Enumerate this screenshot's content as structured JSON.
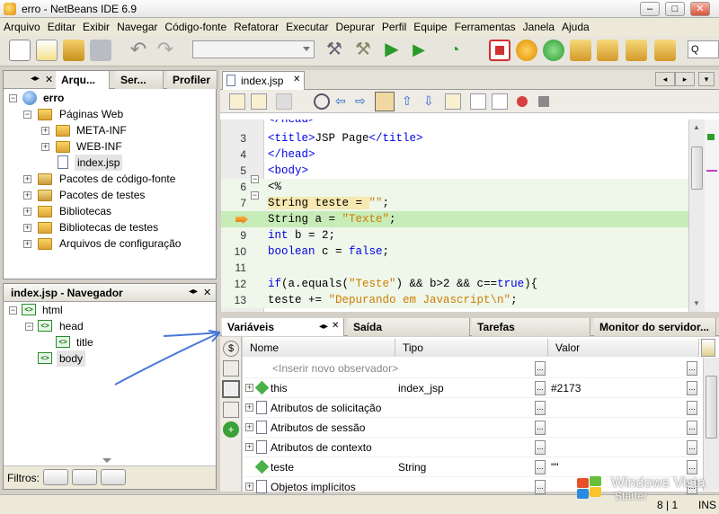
{
  "window": {
    "title": "erro - NetBeans IDE 6.9",
    "min": "‒",
    "max": "□",
    "close": "✕"
  },
  "menu": [
    "Arquivo",
    "Editar",
    "Exibir",
    "Navegar",
    "Código-fonte",
    "Refatorar",
    "Executar",
    "Depurar",
    "Perfil",
    "Equipe",
    "Ferramentas",
    "Janela",
    "Ajuda"
  ],
  "search": {
    "label": "Q"
  },
  "projects": {
    "tabs": [
      "Arqu...",
      "Ser...",
      "Profiler"
    ],
    "tree": [
      {
        "label": "erro",
        "bold": true
      },
      {
        "label": "Páginas Web"
      },
      {
        "label": "META-INF"
      },
      {
        "label": "WEB-INF"
      },
      {
        "label": "index.jsp"
      },
      {
        "label": "Pacotes de código-fonte"
      },
      {
        "label": "Pacotes de testes"
      },
      {
        "label": "Bibliotecas"
      },
      {
        "label": "Bibliotecas de testes"
      },
      {
        "label": "Arquivos de configuração"
      }
    ]
  },
  "navigator": {
    "title": "index.jsp - Navegador",
    "tree": [
      "html",
      "head",
      "title",
      "body"
    ],
    "filters_label": "Filtros:"
  },
  "editor": {
    "tab": "index.jsp",
    "partial_top": "</head>",
    "lines": [
      {
        "n": "3",
        "parts": [
          [
            "tg",
            "<title>"
          ],
          [
            "",
            "JSP Page"
          ],
          [
            "tg",
            "</title>"
          ]
        ]
      },
      {
        "n": "4",
        "parts": [
          [
            "tg",
            "</head>"
          ]
        ]
      },
      {
        "n": "5",
        "parts": [
          [
            "tg",
            "<body>"
          ]
        ]
      },
      {
        "n": "6",
        "parts": [
          [
            "",
            "<%"
          ]
        ]
      },
      {
        "n": "7",
        "parts": [
          [
            "",
            "String teste = "
          ],
          [
            "str",
            "\"\""
          ],
          [
            "",
            ";"
          ]
        ]
      },
      {
        "n": "",
        "parts": [
          [
            "",
            "String a = "
          ],
          [
            "str",
            "\"Texte\""
          ],
          [
            "",
            ";"
          ]
        ]
      },
      {
        "n": "9",
        "parts": [
          [
            "kw",
            "int"
          ],
          [
            "",
            " b = 2;"
          ]
        ]
      },
      {
        "n": "10",
        "parts": [
          [
            "kw",
            "boolean"
          ],
          [
            "",
            " c = "
          ],
          [
            "kw",
            "false"
          ],
          [
            "",
            ";"
          ]
        ]
      },
      {
        "n": "11",
        "parts": [
          [
            "",
            ""
          ]
        ]
      },
      {
        "n": "12",
        "parts": [
          [
            "kw",
            "if"
          ],
          [
            "",
            "(a.equals("
          ],
          [
            "str",
            "\"Teste\""
          ],
          [
            "",
            ") && b>2 && c=="
          ],
          [
            "kw",
            "true"
          ],
          [
            "",
            "){"
          ]
        ]
      },
      {
        "n": "13",
        "parts": [
          [
            "",
            "teste += "
          ],
          [
            "str",
            "\"Depurando em Javascript\\n\""
          ],
          [
            "",
            ";"
          ]
        ]
      }
    ]
  },
  "bottom": {
    "tabs": [
      "Variáveis",
      "Saída",
      "Tarefas",
      "Monitor do servidor..."
    ],
    "columns": [
      "Nome",
      "Tipo",
      "Valor"
    ],
    "rows": [
      {
        "name": "<Inserir novo observador>",
        "type": "",
        "value": "",
        "placeholder": true
      },
      {
        "name": "this",
        "type": "index_jsp",
        "value": "#2173"
      },
      {
        "name": "Atributos de solicitação",
        "type": "",
        "value": ""
      },
      {
        "name": "Atributos de sessão",
        "type": "",
        "value": ""
      },
      {
        "name": "Atributos de contexto",
        "type": "",
        "value": ""
      },
      {
        "name": "teste",
        "type": "String",
        "value": "\"\""
      },
      {
        "name": "Objetos implícitos",
        "type": "",
        "value": ""
      }
    ]
  },
  "status": {
    "position": "8 | 1",
    "mode": "INS"
  },
  "watermark": {
    "line1": "Windows Vista",
    "line2": "Starter"
  }
}
